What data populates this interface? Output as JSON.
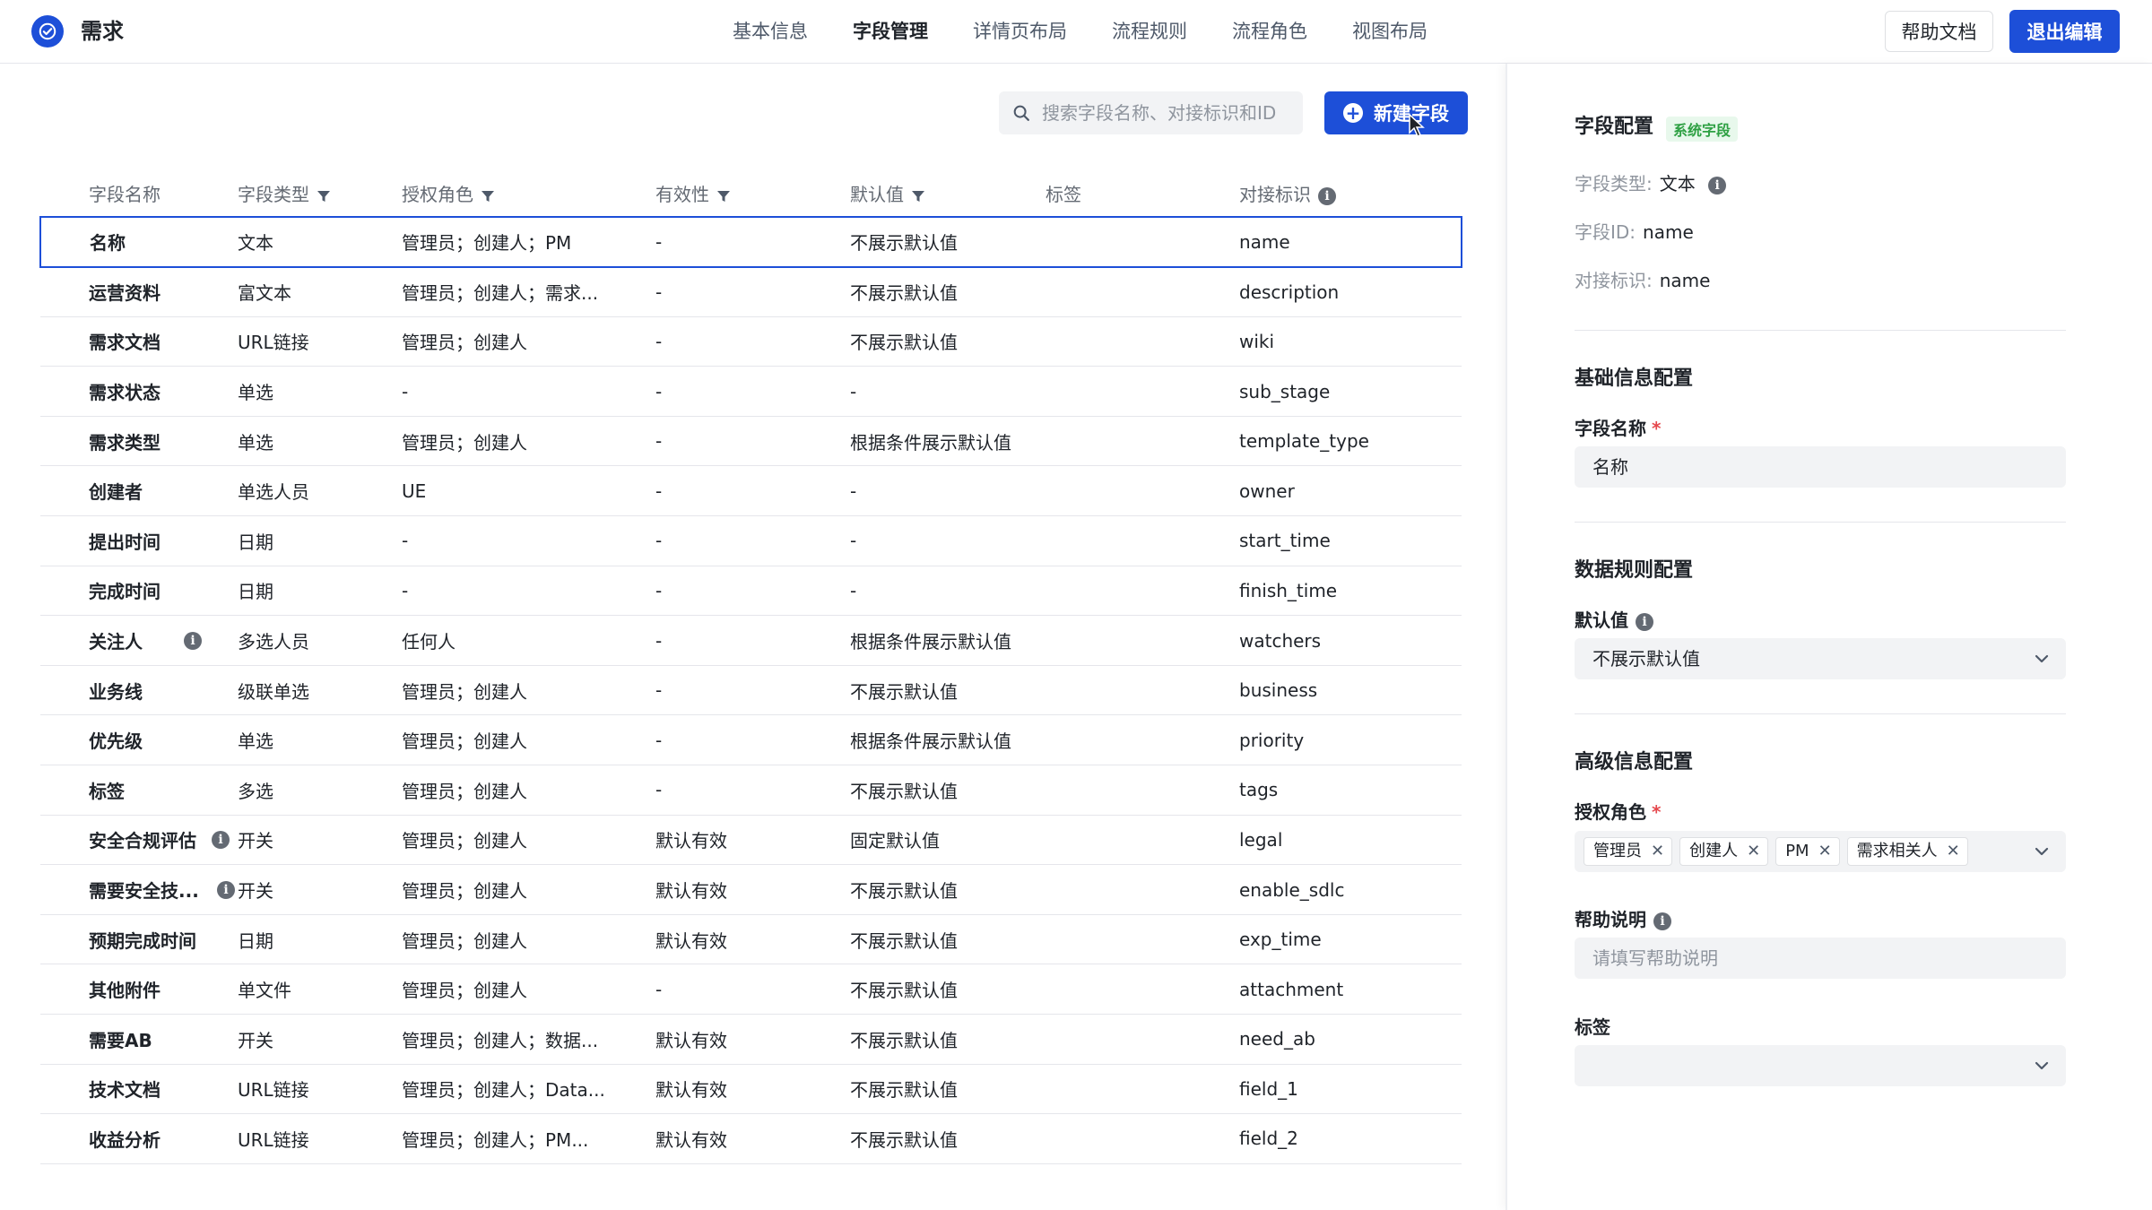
{
  "app": {
    "title": "需求"
  },
  "nav": [
    "基本信息",
    "字段管理",
    "详情页布局",
    "流程规则",
    "流程角色",
    "视图布局"
  ],
  "nav_active": 1,
  "header": {
    "help_label": "帮助文档",
    "exit_label": "退出编辑"
  },
  "toolbar": {
    "search_placeholder": "搜索字段名称、对接标识和ID",
    "new_field_label": "新建字段"
  },
  "table": {
    "columns": [
      "字段名称",
      "字段类型",
      "授权角色",
      "有效性",
      "默认值",
      "标签",
      "对接标识"
    ],
    "rows": [
      [
        "名称",
        "文本",
        "管理员；创建人；PM",
        "-",
        "不展示默认值",
        "",
        "name"
      ],
      [
        "运营资料",
        "富文本",
        "管理员；创建人；需求...",
        "-",
        "不展示默认值",
        "",
        "description"
      ],
      [
        "需求文档",
        "URL链接",
        "管理员；创建人",
        "-",
        "不展示默认值",
        "",
        "wiki"
      ],
      [
        "需求状态",
        "单选",
        "-",
        "-",
        "-",
        "",
        "sub_stage"
      ],
      [
        "需求类型",
        "单选",
        "管理员；创建人",
        "-",
        "根据条件展示默认值",
        "",
        "template_type"
      ],
      [
        "创建者",
        "单选人员",
        "UE",
        "-",
        "-",
        "",
        "owner"
      ],
      [
        "提出时间",
        "日期",
        "-",
        "-",
        "-",
        "",
        "start_time"
      ],
      [
        "完成时间",
        "日期",
        "-",
        "-",
        "-",
        "",
        "finish_time"
      ],
      [
        "关注人",
        "多选人员",
        "任何人",
        "-",
        "根据条件展示默认值",
        "",
        "watchers"
      ],
      [
        "业务线",
        "级联单选",
        "管理员；创建人",
        "-",
        "不展示默认值",
        "",
        "business"
      ],
      [
        "优先级",
        "单选",
        "管理员；创建人",
        "-",
        "根据条件展示默认值",
        "",
        "priority"
      ],
      [
        "标签",
        "多选",
        "管理员；创建人",
        "-",
        "不展示默认值",
        "",
        "tags"
      ],
      [
        "安全合规评估",
        "开关",
        "管理员；创建人",
        "默认有效",
        "固定默认值",
        "",
        "legal"
      ],
      [
        "需要安全技...",
        "开关",
        "管理员；创建人",
        "默认有效",
        "不展示默认值",
        "",
        "enable_sdlc"
      ],
      [
        "预期完成时间",
        "日期",
        "管理员；创建人",
        "默认有效",
        "不展示默认值",
        "",
        "exp_time"
      ],
      [
        "其他附件",
        "单文件",
        "管理员；创建人",
        "-",
        "不展示默认值",
        "",
        "attachment"
      ],
      [
        "需要AB",
        "开关",
        "管理员；创建人；数据...",
        "默认有效",
        "不展示默认值",
        "",
        "need_ab"
      ],
      [
        "技术文档",
        "URL链接",
        "管理员；创建人；Data...",
        "默认有效",
        "不展示默认值",
        "",
        "field_1"
      ],
      [
        "收益分析",
        "URL链接",
        "管理员；创建人；PM...",
        "默认有效",
        "不展示默认值",
        "",
        "field_2"
      ]
    ],
    "info_rows": [
      8,
      12,
      13
    ]
  },
  "panel": {
    "title": "字段配置",
    "badge": "系统字段",
    "type_label": "字段类型:",
    "type_value": "文本",
    "id_label": "字段ID:",
    "id_value": "name",
    "key_label": "对接标识:",
    "key_value": "name",
    "basic_title": "基础信息配置",
    "name_label": "字段名称",
    "name_value": "名称",
    "data_title": "数据规则配置",
    "default_label": "默认值",
    "default_value": "不展示默认值",
    "adv_title": "高级信息配置",
    "role_label": "授权角色",
    "roles": [
      "管理员",
      "创建人",
      "PM",
      "需求相关人"
    ],
    "help_label": "帮助说明",
    "help_placeholder": "请填写帮助说明",
    "tag_label": "标签",
    "required_mark": "*"
  },
  "colors": {
    "accent": "#1d4fd8",
    "badge_bg": "#e8f8ec",
    "badge_text": "#2ea043",
    "required": "#e5484d"
  }
}
